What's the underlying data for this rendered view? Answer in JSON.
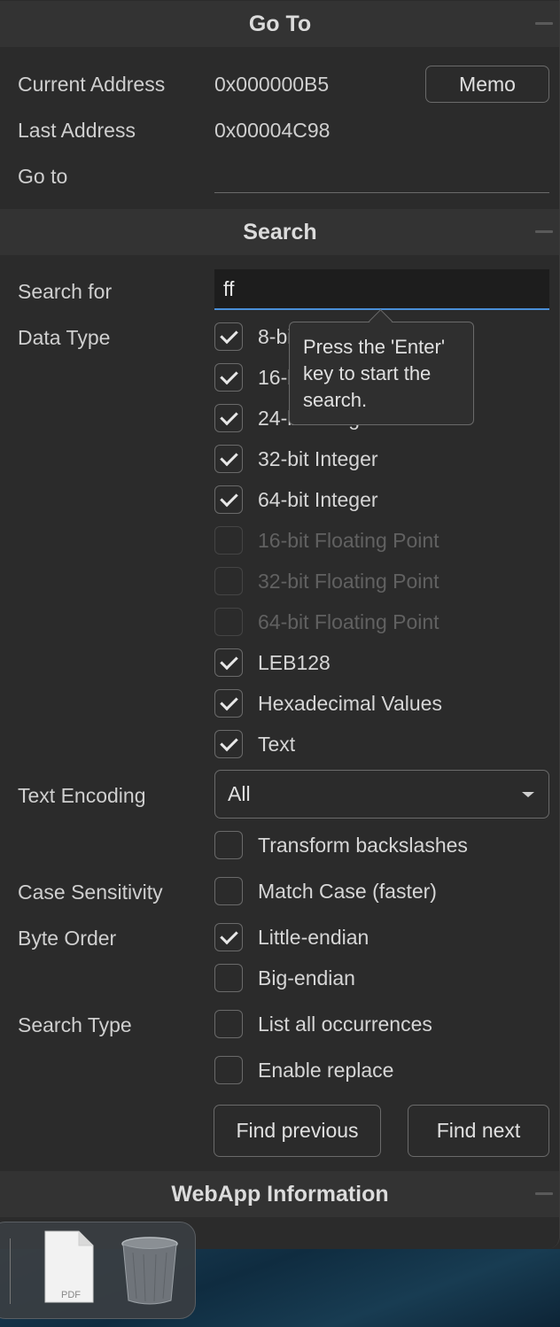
{
  "goto": {
    "header": "Go To",
    "current_address_label": "Current Address",
    "current_address_value": "0x000000B5",
    "memo_button": "Memo",
    "last_address_label": "Last Address",
    "last_address_value": "0x00004C98",
    "goto_label": "Go to",
    "goto_value": ""
  },
  "search": {
    "header": "Search",
    "search_for_label": "Search for",
    "search_for_value": "ff",
    "tooltip": "Press the 'Enter' key to start the search.",
    "data_type_label": "Data Type",
    "data_types": [
      {
        "label": "8-bit Integer",
        "checked": true,
        "disabled": false
      },
      {
        "label": "16-bit Integer",
        "checked": true,
        "disabled": false
      },
      {
        "label": "24-bit Integer",
        "checked": true,
        "disabled": false
      },
      {
        "label": "32-bit Integer",
        "checked": true,
        "disabled": false
      },
      {
        "label": "64-bit Integer",
        "checked": true,
        "disabled": false
      },
      {
        "label": "16-bit Floating Point",
        "checked": false,
        "disabled": true
      },
      {
        "label": "32-bit Floating Point",
        "checked": false,
        "disabled": true
      },
      {
        "label": "64-bit Floating Point",
        "checked": false,
        "disabled": true
      },
      {
        "label": "LEB128",
        "checked": true,
        "disabled": false
      },
      {
        "label": "Hexadecimal Values",
        "checked": true,
        "disabled": false
      },
      {
        "label": "Text",
        "checked": true,
        "disabled": false
      }
    ],
    "text_encoding_label": "Text Encoding",
    "text_encoding_value": "All",
    "transform_backslashes": {
      "label": "Transform backslashes",
      "checked": false
    },
    "case_sensitivity_label": "Case Sensitivity",
    "match_case": {
      "label": "Match Case (faster)",
      "checked": false
    },
    "byte_order_label": "Byte Order",
    "little_endian": {
      "label": "Little-endian",
      "checked": true
    },
    "big_endian": {
      "label": "Big-endian",
      "checked": false
    },
    "search_type_label": "Search Type",
    "list_all": {
      "label": "List all occurrences",
      "checked": false
    },
    "enable_replace": {
      "label": "Enable replace",
      "checked": false
    },
    "find_previous": "Find previous",
    "find_next": "Find next"
  },
  "webapp": {
    "header": "WebApp Information"
  },
  "dock": {
    "items": [
      {
        "name": "pdf-document",
        "label": "PDF"
      },
      {
        "name": "trash",
        "label": ""
      }
    ]
  }
}
